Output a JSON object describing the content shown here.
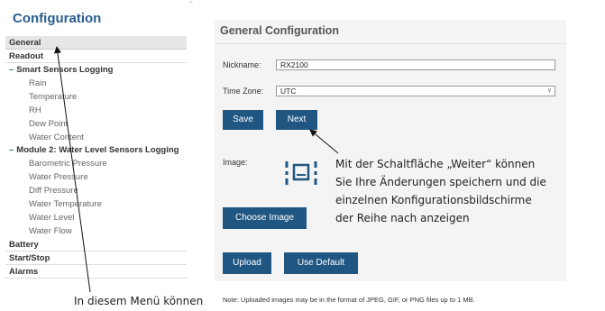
{
  "sidebar": {
    "title": "Configuration",
    "items": [
      {
        "label": "General",
        "kind": "top",
        "selected": true
      },
      {
        "label": "Readout",
        "kind": "top"
      },
      {
        "label": "Smart Sensors Logging",
        "kind": "section"
      },
      {
        "label": "Rain",
        "kind": "sub"
      },
      {
        "label": "Temperature",
        "kind": "sub"
      },
      {
        "label": "RH",
        "kind": "sub"
      },
      {
        "label": "Dew Point",
        "kind": "sub"
      },
      {
        "label": "Water Content",
        "kind": "sub"
      },
      {
        "label": "Module 2: Water Level Sensors Logging",
        "kind": "section",
        "two_line": true
      },
      {
        "label": "Barometric Pressure",
        "kind": "sub"
      },
      {
        "label": "Water Pressure",
        "kind": "sub"
      },
      {
        "label": "Diff Pressure",
        "kind": "sub"
      },
      {
        "label": "Water Temperature",
        "kind": "sub"
      },
      {
        "label": "Water Level",
        "kind": "sub"
      },
      {
        "label": "Water Flow",
        "kind": "sub"
      },
      {
        "label": "Battery",
        "kind": "top"
      },
      {
        "label": "Start/Stop",
        "kind": "top"
      },
      {
        "label": "Alarms",
        "kind": "top"
      }
    ]
  },
  "main": {
    "title": "General Configuration",
    "nickname_label": "Nickname:",
    "nickname_value": "RX2100",
    "timezone_label": "Time Zone:",
    "timezone_value": "UTC",
    "save_label": "Save",
    "next_label": "Next",
    "image_label": "Image:",
    "image_icon": "image-placeholder-icon",
    "choose_image_label": "Choose Image",
    "upload_label": "Upload",
    "use_default_label": "Use Default",
    "note": "Note: Uploaded images may be in the format of JPEG, GIF, or PNG files up to 1 MB."
  },
  "annotations": {
    "menu_callout": "In diesem Menü können",
    "next_callout": [
      "Mit der Schaltfläche „Weiter“ können",
      "Sie Ihre Änderungen speichern und die",
      "einzelnen Konfigurationsbildschirme",
      "der Reihe nach anzeigen"
    ]
  },
  "colors": {
    "accent": "#1f5682",
    "title": "#2a5d8e",
    "panel_bg": "#f4f4f4"
  }
}
